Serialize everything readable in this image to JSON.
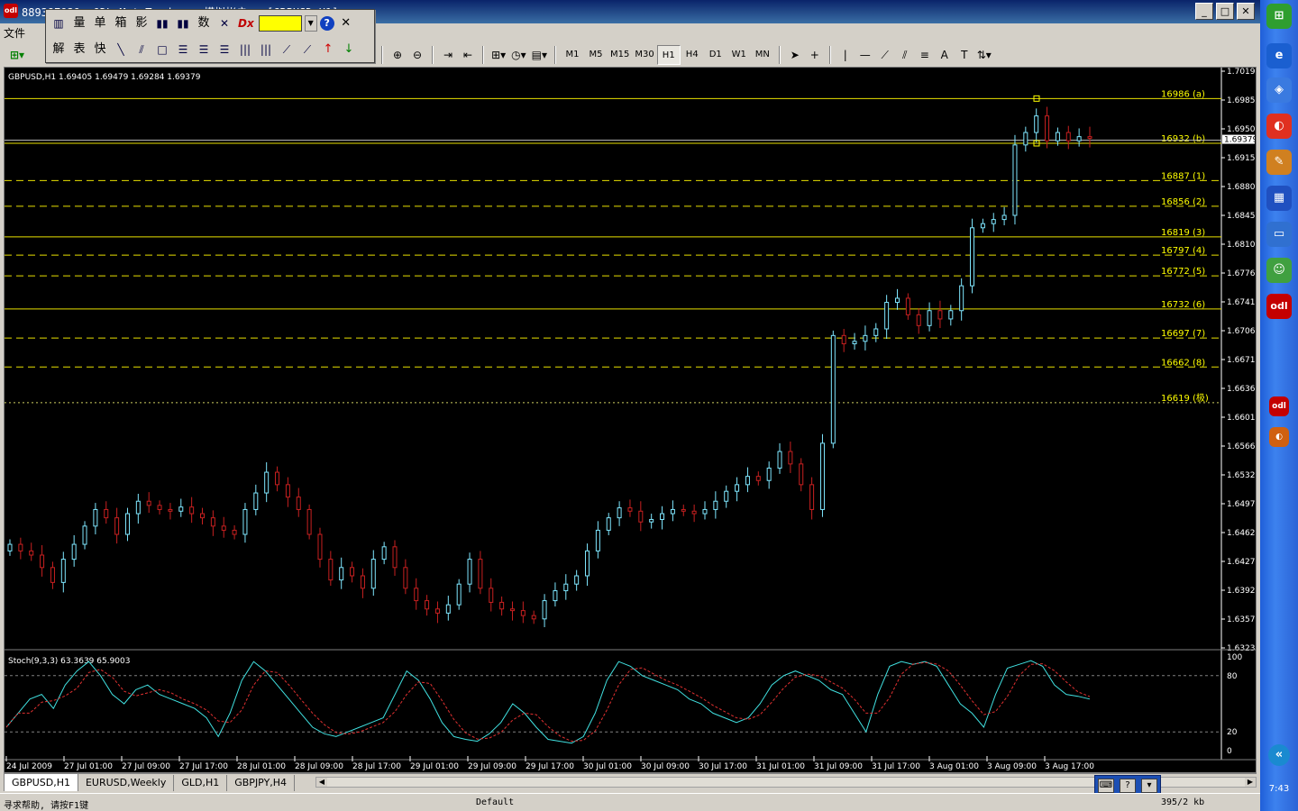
{
  "window": {
    "app_icon": "odl",
    "title": "8893?7939: ODL MetaTrader - 模拟帐户 - [GBPUSD,H1]",
    "minimize": "_",
    "maximize": "□",
    "close": "✕"
  },
  "menu": {
    "first_item": "文件"
  },
  "floating_toolbar": {
    "row1": [
      "量",
      "单",
      "箱",
      "影",
      "数"
    ],
    "row2": [
      "解",
      "表",
      "快"
    ],
    "color": "#ffff00"
  },
  "toolbar": {
    "periods": [
      "M1",
      "M5",
      "M15",
      "M30",
      "H1",
      "H4",
      "D1",
      "W1",
      "MN"
    ],
    "active_period": "H1"
  },
  "chart": {
    "symbol_info": "GBPUSD,H1  1.69405 1.69479 1.69284 1.69379",
    "current_price": "1.69379",
    "price_ticks": [
      "1.70190",
      "1.69850",
      "1.69500",
      "1.69150",
      "1.68800",
      "1.68450",
      "1.68100",
      "1.67760",
      "1.67410",
      "1.67060",
      "1.66710",
      "1.66360",
      "1.66010",
      "1.65660",
      "1.65320",
      "1.64970",
      "1.64620",
      "1.64270",
      "1.63920",
      "1.63570",
      "1.63230"
    ],
    "fib_levels": [
      {
        "label": "16986 (a)",
        "price": 1.6986,
        "style": "solid"
      },
      {
        "label": "16932 (b)",
        "price": 1.6932,
        "style": "solid"
      },
      {
        "label": "16887 (1)",
        "price": 1.6887,
        "style": "dashed"
      },
      {
        "label": "16856 (2)",
        "price": 1.6856,
        "style": "dashed"
      },
      {
        "label": "16819 (3)",
        "price": 1.6819,
        "style": "solid"
      },
      {
        "label": "16797 (4)",
        "price": 1.6797,
        "style": "dashed"
      },
      {
        "label": "16772 (5)",
        "price": 1.6772,
        "style": "dashed"
      },
      {
        "label": "16732 (6)",
        "price": 1.6732,
        "style": "solid"
      },
      {
        "label": "16697 (7)",
        "price": 1.6697,
        "style": "dashed"
      },
      {
        "label": "16662 (8)",
        "price": 1.6662,
        "style": "dashed"
      },
      {
        "label": "16619 (极)",
        "price": 1.6619,
        "style": "dotted"
      }
    ],
    "stoch_label": "Stoch(9,3,3) 63.3639 65.9003",
    "stoch_levels": [
      "100",
      "80",
      "20",
      "0"
    ],
    "time_labels": [
      "24 Jul 2009",
      "27 Jul 01:00",
      "27 Jul 09:00",
      "27 Jul 17:00",
      "28 Jul 01:00",
      "28 Jul 09:00",
      "28 Jul 17:00",
      "29 Jul 01:00",
      "29 Jul 09:00",
      "29 Jul 17:00",
      "30 Jul 01:00",
      "30 Jul 09:00",
      "30 Jul 17:00",
      "31 Jul 01:00",
      "31 Jul 09:00",
      "31 Jul 17:00",
      "3 Aug 01:00",
      "3 Aug 09:00",
      "3 Aug 17:00"
    ]
  },
  "tabs": [
    "GBPUSD,H1",
    "EURUSD,Weekly",
    "GLD,H1",
    "GBPJPY,H4"
  ],
  "active_tab": "GBPUSD,H1",
  "status": {
    "help": "寻求帮助, 请按F1键",
    "profile": "Default",
    "traffic": "395/2 kb"
  },
  "taskbar": {
    "time": "7:43"
  },
  "chart_data": {
    "type": "line",
    "title": "",
    "series": [],
    "ylim": [
      1.6323,
      1.7019
    ],
    "note_candles": "hourly candlesticks"
  }
}
